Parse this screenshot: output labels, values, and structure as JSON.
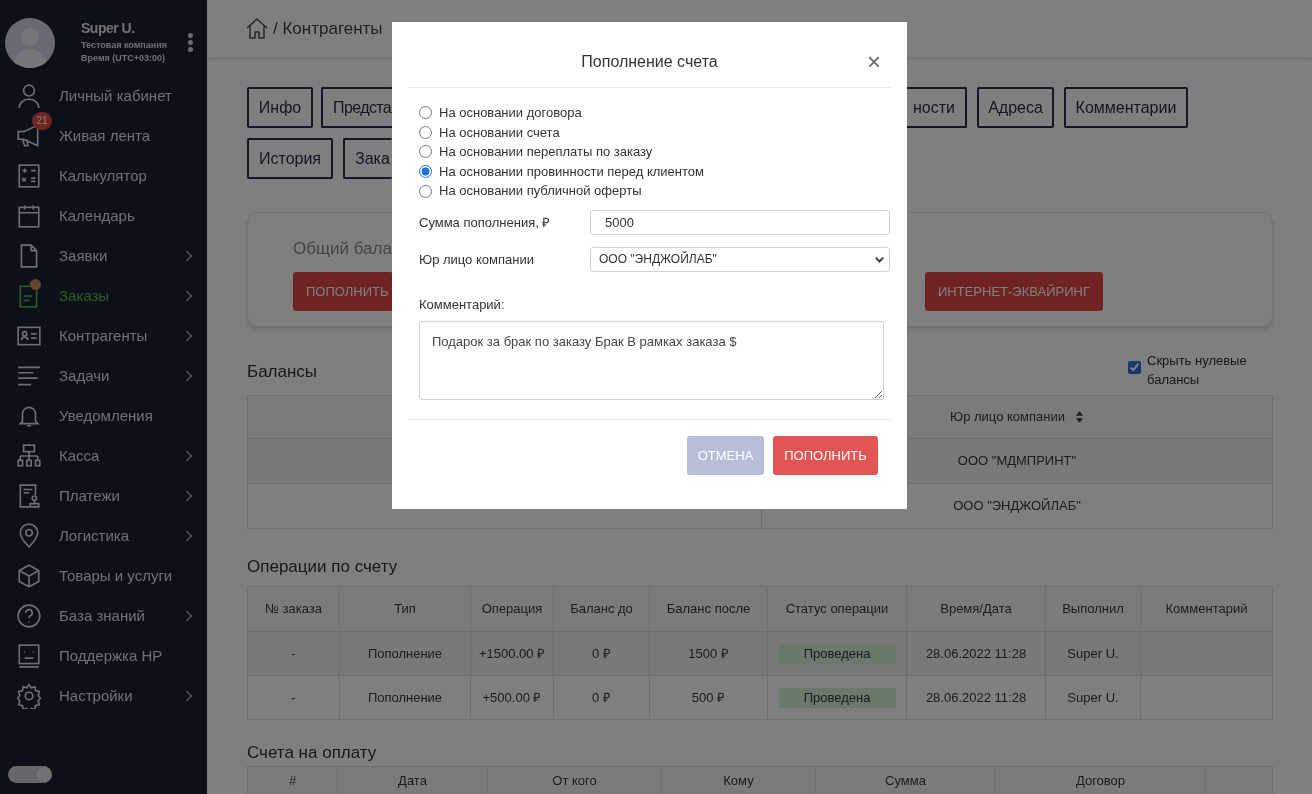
{
  "sidebar": {
    "user": {
      "name": "Super U.",
      "company": "Тестовая компания",
      "timezone": "Время (UTC+03:00)"
    },
    "items": [
      {
        "label": "Личный кабинет",
        "selected": false,
        "expandable": false
      },
      {
        "label": "Живая лента",
        "selected": false,
        "expandable": false,
        "badge": "21"
      },
      {
        "label": "Калькулятор",
        "selected": false,
        "expandable": false
      },
      {
        "label": "Календарь",
        "selected": false,
        "expandable": false
      },
      {
        "label": "Заявки",
        "selected": false,
        "expandable": true
      },
      {
        "label": "Заказы",
        "selected": true,
        "expandable": true,
        "dot": true
      },
      {
        "label": "Контрагенты",
        "selected": false,
        "expandable": true
      },
      {
        "label": "Задачи",
        "selected": false,
        "expandable": true
      },
      {
        "label": "Уведомления",
        "selected": false,
        "expandable": false
      },
      {
        "label": "Касса",
        "selected": false,
        "expandable": true
      },
      {
        "label": "Платежи",
        "selected": false,
        "expandable": true
      },
      {
        "label": "Логистика",
        "selected": false,
        "expandable": true
      },
      {
        "label": "Товары и услуги",
        "selected": false,
        "expandable": false
      },
      {
        "label": "База знаний",
        "selected": false,
        "expandable": true
      },
      {
        "label": "Поддержка HP",
        "selected": false,
        "expandable": false
      },
      {
        "label": "Настройки",
        "selected": false,
        "expandable": true
      }
    ],
    "theme_toggle": {
      "on": true
    }
  },
  "breadcrumb": {
    "text": "/ Контрагенты"
  },
  "tabs": [
    [
      {
        "label": "Инфо",
        "selected": false
      },
      {
        "label": "Предста",
        "selected": false
      },
      {
        "label": "ности",
        "selected": false
      },
      {
        "label": "Адреса",
        "selected": false
      },
      {
        "label": "Комментарии",
        "selected": false
      }
    ],
    [
      {
        "label": "История",
        "selected": false
      },
      {
        "label": "Зака",
        "selected": false
      }
    ]
  ],
  "balance_card": {
    "title": "Общий бала",
    "buttons": [
      "ПОПОЛНИТЬ",
      "ИНТЕРНЕТ-ЭКВАЙРИНГ"
    ]
  },
  "balances": {
    "title": "Балансы",
    "hide_zero": {
      "label": "Скрыть нулевые балансы",
      "checked": true
    },
    "column_2": {
      "label": "Юр лицо компании",
      "sortable": true
    },
    "rows": [
      {
        "column_2": "ООО \"МДМПРИНТ\""
      },
      {
        "column_2": "ООО \"ЭНДЖОЙЛАБ\""
      }
    ]
  },
  "operations": {
    "title": "Операции по счету",
    "columns": [
      {
        "label": "№ заказа"
      },
      {
        "label": "Тип"
      },
      {
        "label": "Операция"
      },
      {
        "label": "Баланс до"
      },
      {
        "label": "Баланс после"
      },
      {
        "label": "Статус операции",
        "kind": "status"
      },
      {
        "label": "Время/Дата"
      },
      {
        "label": "Выполнил"
      },
      {
        "label": "Комментарий"
      }
    ],
    "rows": [
      [
        "-",
        "Пополнение",
        "+1500.00 ₽",
        "0 ₽",
        "1500 ₽",
        "Проведена",
        "28.06.2022 11:28",
        "Super U."
      ],
      [
        "-",
        "Пополнение",
        "+500.00 ₽",
        "0 ₽",
        "500 ₽",
        "Проведена",
        "28.06.2022 11:28",
        "Super U."
      ]
    ]
  },
  "invoices": {
    "title": "Счета на оплату",
    "columns": [
      "#",
      "Дата",
      "От кого",
      "Кому",
      "Сумма",
      "Договор"
    ]
  },
  "modal": {
    "title": "Пополнение счета",
    "close": "×",
    "options": [
      {
        "label": "На основании договора",
        "selected": false
      },
      {
        "label": "На основании счета",
        "selected": false
      },
      {
        "label": "На основании переплаты по заказу",
        "selected": false
      },
      {
        "label": "На основании провинности перед клиентом",
        "selected": true
      },
      {
        "label": "На основании публичной оферты",
        "selected": false
      }
    ],
    "amount": {
      "label": "Сумма пополнения, ₽",
      "value": "5000"
    },
    "company": {
      "label": "Юр лицо компании",
      "value": "ООО \"ЭНДЖОЙЛАБ\""
    },
    "comment": {
      "label": "Комментарий:",
      "value": "Подарок за брак по заказу Брак В рамках заказа $"
    },
    "buttons": {
      "cancel": "ОТМЕНА",
      "submit": "ПОПОЛНИТЬ"
    }
  }
}
